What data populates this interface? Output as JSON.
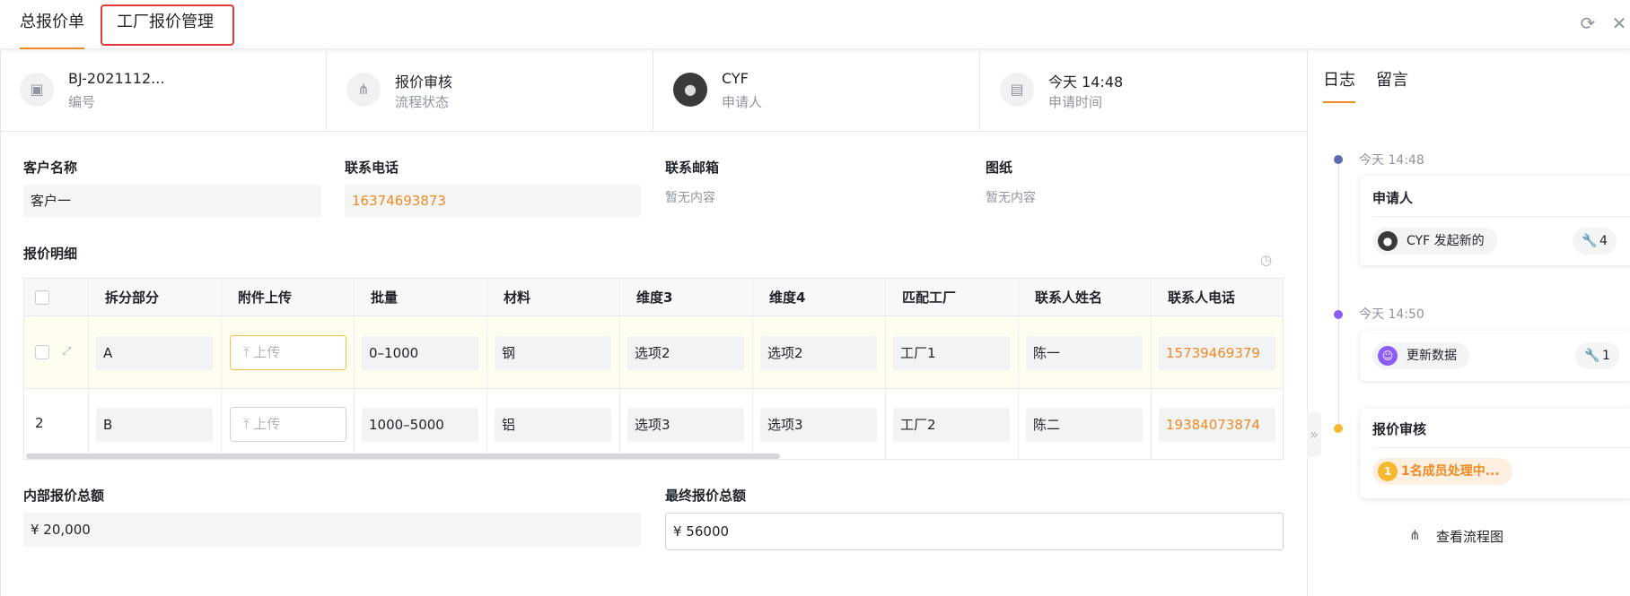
{
  "tabs": [
    {
      "label": "总报价单"
    },
    {
      "label": "工厂报价管理"
    }
  ],
  "header_icons": {
    "refresh": "refresh-icon",
    "close": "close-icon"
  },
  "info": [
    {
      "value": "BJ-2021112...",
      "label": "编号",
      "icon": "document-icon"
    },
    {
      "value": "报价审核",
      "label": "流程状态",
      "icon": "flow-icon"
    },
    {
      "value": "CYF",
      "label": "申请人",
      "icon": "avatar"
    },
    {
      "value": "今天 14:48",
      "label": "申请时间",
      "icon": "calendar-icon"
    }
  ],
  "form": {
    "customer": {
      "label": "客户名称",
      "value": "客户一"
    },
    "phone": {
      "label": "联系电话",
      "value": "16374693873"
    },
    "email": {
      "label": "联系邮箱",
      "value": "暂无内容"
    },
    "drawing": {
      "label": "图纸",
      "value": "暂无内容"
    }
  },
  "table": {
    "title": "报价明细",
    "columns": [
      "拆分部分",
      "附件上传",
      "批量",
      "材料",
      "维度3",
      "维度4",
      "匹配工厂",
      "联系人姓名",
      "联系人电话"
    ],
    "upload_label": "上传",
    "rows": [
      {
        "index": "",
        "part": "A",
        "batch": "0–1000",
        "material": "钢",
        "dim3": "选项2",
        "dim4": "选项2",
        "factory": "工厂1",
        "contact": "陈一",
        "phone": "15739469379"
      },
      {
        "index": "2",
        "part": "B",
        "batch": "1000–5000",
        "material": "铝",
        "dim3": "选项3",
        "dim4": "选项3",
        "factory": "工厂2",
        "contact": "陈二",
        "phone": "19384073874"
      }
    ]
  },
  "totals": {
    "internal": {
      "label": "内部报价总额",
      "value": "¥ 20,000"
    },
    "final": {
      "label": "最终报价总额",
      "value": "¥ 56000"
    }
  },
  "sidebar": {
    "tabs": [
      "日志",
      "留言"
    ],
    "timeline": [
      {
        "time": "今天 14:48",
        "title": "申请人",
        "pill": "CYF 发起新的",
        "count": "4",
        "color": "#5b6bb0"
      },
      {
        "time": "今天 14:50",
        "title": "",
        "pill": "更新数据",
        "count": "1",
        "color": "#8b5cf6"
      },
      {
        "time": "",
        "title": "报价审核",
        "pill": "1名成员处理中...",
        "pill_num": "1",
        "color": "#f5b82e"
      }
    ],
    "flow_link": "查看流程图"
  }
}
